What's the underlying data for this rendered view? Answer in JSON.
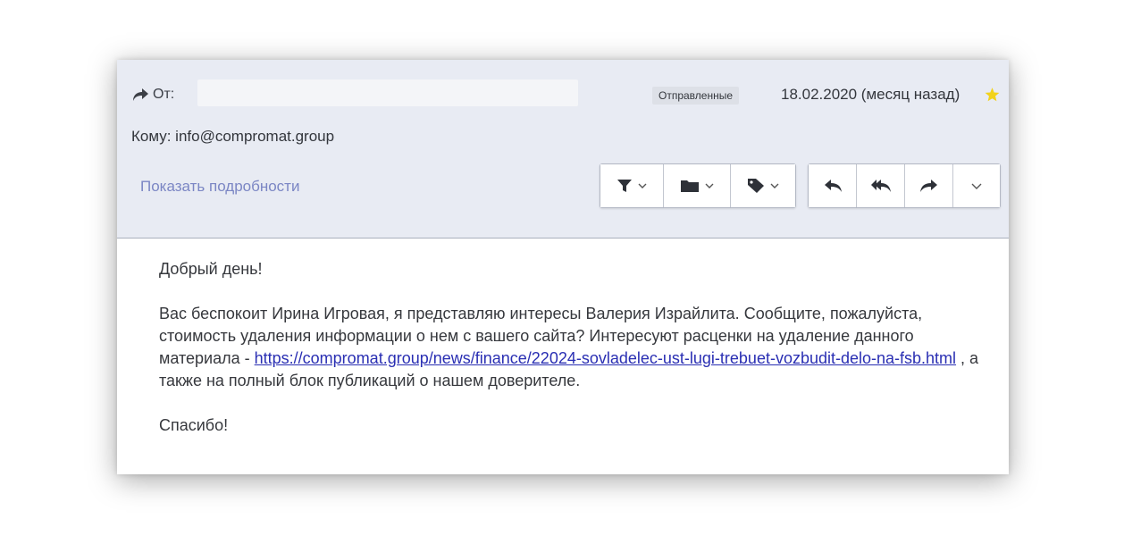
{
  "header": {
    "from_label": "От:",
    "folder_badge": "Отправленные",
    "date": "18.02.2020 (месяц назад)",
    "to_line": "Кому: info@compromat.group",
    "details_link": "Показать подробности"
  },
  "toolbar": {
    "left_group": [
      {
        "icon": "filter-icon"
      },
      {
        "icon": "folder-icon"
      },
      {
        "icon": "tag-icon"
      }
    ],
    "right_group": [
      {
        "icon": "reply-icon"
      },
      {
        "icon": "reply-all-icon"
      },
      {
        "icon": "forward-icon"
      },
      {
        "icon": "chevron-down-icon"
      }
    ]
  },
  "message": {
    "greeting": "Добрый день!",
    "para_before_link": "Вас беспокоит Ирина Игровая, я представляю интересы Валерия Израйлита. Сообщите, пожалуйста, стоимость удаления информации о нем с вашего сайта? Интересуют расценки на удаление данного материала - ",
    "link_text": "https://compromat.group/news/finance/22024-sovladelec-ust-lugi-trebuet-vozbudit-delo-na-fsb.html",
    "para_after_link": " , а также на полный блок публикаций о нашем доверителе.",
    "closing": "Спасибо!"
  },
  "colors": {
    "header_bg": "#e8ebf3",
    "link": "#2a2fb3",
    "details_link": "#7b86c4",
    "star": "#f2d21b"
  }
}
